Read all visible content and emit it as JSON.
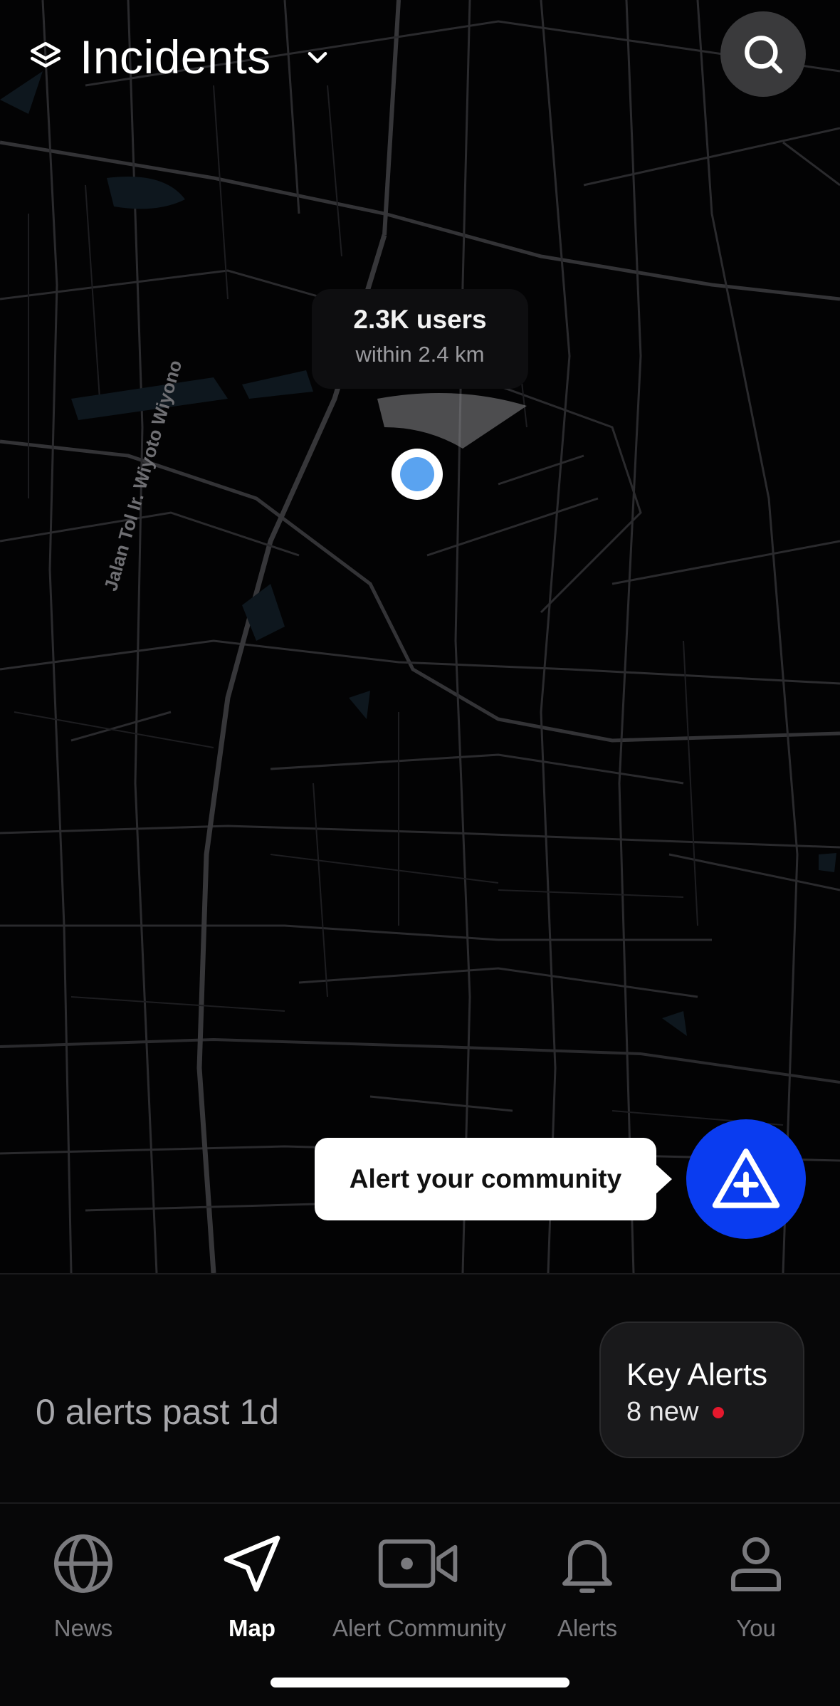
{
  "header": {
    "title": "Incidents",
    "layers_icon": "layers-icon",
    "chevron_icon": "chevron-down-icon",
    "search_icon": "search-icon"
  },
  "map": {
    "users_count": "2.3K users",
    "users_range": "within 2.4 km",
    "road_label": "Jalan Tol Ir. Wiyoto Wiyono"
  },
  "fab": {
    "tooltip": "Alert your community",
    "icon": "warning-plus-icon",
    "color": "#0a3cf0"
  },
  "summary": {
    "alerts_past": "0 alerts past 1d",
    "key_alerts_title": "Key Alerts",
    "key_alerts_new": "8 new",
    "new_indicator_color": "#e5182d"
  },
  "tabs": [
    {
      "label": "News",
      "icon": "globe-icon",
      "active": false
    },
    {
      "label": "Map",
      "icon": "navigation-arrow-icon",
      "active": true
    },
    {
      "label": "Alert Community",
      "icon": "video-camera-icon",
      "active": false
    },
    {
      "label": "Alerts",
      "icon": "bell-icon",
      "active": false
    },
    {
      "label": "You",
      "icon": "person-icon",
      "active": false
    }
  ]
}
